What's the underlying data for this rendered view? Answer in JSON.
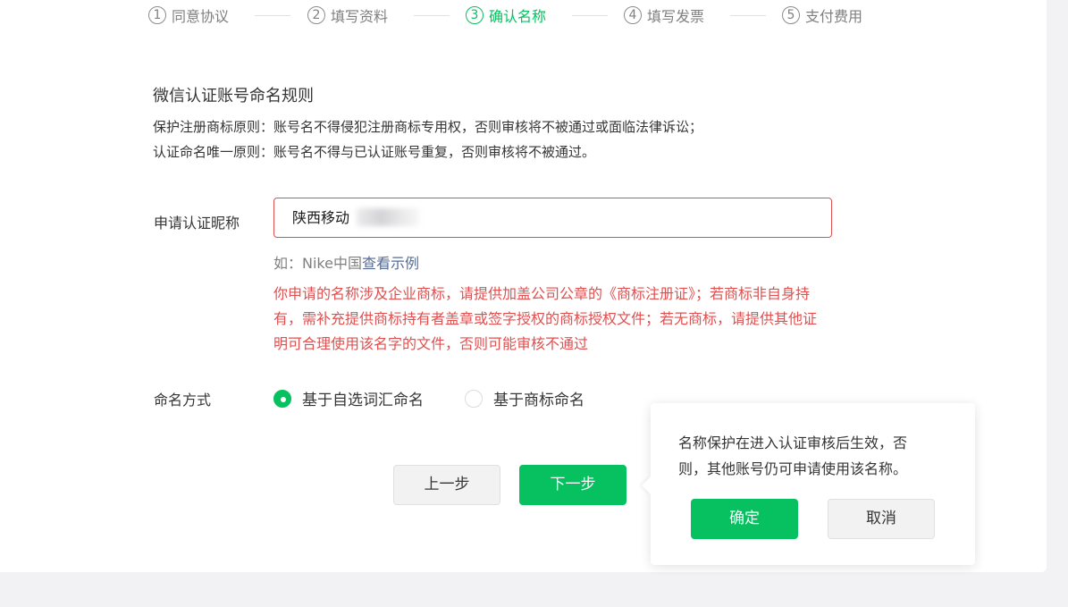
{
  "steps": [
    {
      "num": "1",
      "label": "同意协议",
      "active": false
    },
    {
      "num": "2",
      "label": "填写资料",
      "active": false
    },
    {
      "num": "3",
      "label": "确认名称",
      "active": true
    },
    {
      "num": "4",
      "label": "填写发票",
      "active": false
    },
    {
      "num": "5",
      "label": "支付费用",
      "active": false
    }
  ],
  "rules": {
    "title": "微信认证账号命名规则",
    "line1": "保护注册商标原则：账号名不得侵犯注册商标专用权，否则审核将不被通过或面临法律诉讼；",
    "line2": "认证命名唯一原则：账号名不得与已认证账号重复，否则审核将不被通过。"
  },
  "nickname": {
    "label": "申请认证昵称",
    "value": "陕西移动",
    "hint_prefix": "如：Nike中国",
    "hint_link": "查看示例",
    "warning_line1": "你申请的名称涉及企业商标，请提供加盖公司公章的《商标注册证》；若商标非自身持",
    "warning_line2": "有，需补充提供商标持有者盖章或签字授权的商标授权文件；若无商标，请提供其他证",
    "warning_line3": "明可合理使用该名字的文件，否则可能审核不通过"
  },
  "naming": {
    "label": "命名方式",
    "option1": "基于自选词汇命名",
    "option2": "基于商标命名",
    "selected": "option1"
  },
  "buttons": {
    "prev": "上一步",
    "next": "下一步"
  },
  "popover": {
    "line1": "名称保护在进入认证审核后生效，否",
    "line2": "则，其他账号仍可申请使用该名称。",
    "confirm": "确定",
    "cancel": "取消"
  },
  "colors": {
    "primary": "#07c160",
    "error": "#e14f4f",
    "link": "#576b95"
  }
}
